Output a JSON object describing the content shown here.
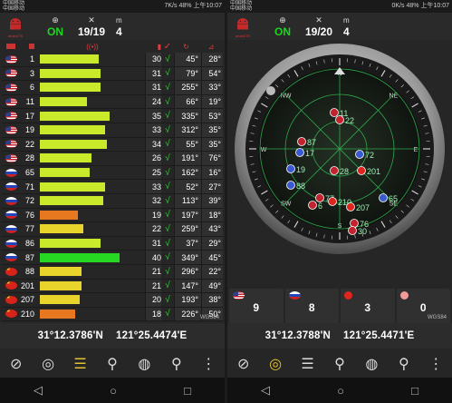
{
  "status_left": {
    "carrier1": "中国移动",
    "carrier2": "中国移动",
    "speed": "7K/s",
    "battery": "48%",
    "time": "上午10:07"
  },
  "status_right": {
    "carrier1": "中国移动",
    "carrier2": "中国移动",
    "speed": "0K/s",
    "battery": "48%",
    "time": "上午10:07"
  },
  "left_header": {
    "brand": "androiTS",
    "state": "ON",
    "sats": "19/19",
    "count": "4",
    "m_label": "m"
  },
  "right_header": {
    "brand": "androiTS",
    "state": "ON",
    "sats": "19/20",
    "count": "4",
    "m_label": "m"
  },
  "table": {
    "rows": [
      {
        "flag": "us",
        "prn": "1",
        "snr": "30",
        "fix": "√",
        "az": "45°",
        "el": "28°",
        "bar": 0.56,
        "color": "#c8ea2a"
      },
      {
        "flag": "us",
        "prn": "3",
        "snr": "31",
        "fix": "√",
        "az": "79°",
        "el": "54°",
        "bar": 0.58,
        "color": "#c8ea2a"
      },
      {
        "flag": "us",
        "prn": "6",
        "snr": "31",
        "fix": "√",
        "az": "255°",
        "el": "33°",
        "bar": 0.58,
        "color": "#c8ea2a"
      },
      {
        "flag": "us",
        "prn": "11",
        "snr": "24",
        "fix": "√",
        "az": "66°",
        "el": "19°",
        "bar": 0.45,
        "color": "#c8ea2a"
      },
      {
        "flag": "us",
        "prn": "17",
        "snr": "35",
        "fix": "√",
        "az": "335°",
        "el": "53°",
        "bar": 0.66,
        "color": "#c8ea2a"
      },
      {
        "flag": "us",
        "prn": "19",
        "snr": "33",
        "fix": "√",
        "az": "312°",
        "el": "35°",
        "bar": 0.62,
        "color": "#c8ea2a"
      },
      {
        "flag": "us",
        "prn": "22",
        "snr": "34",
        "fix": "√",
        "az": "55°",
        "el": "35°",
        "bar": 0.64,
        "color": "#c8ea2a"
      },
      {
        "flag": "us",
        "prn": "28",
        "snr": "26",
        "fix": "√",
        "az": "191°",
        "el": "76°",
        "bar": 0.49,
        "color": "#c8ea2a"
      },
      {
        "flag": "ru",
        "prn": "65",
        "snr": "25",
        "fix": "√",
        "az": "162°",
        "el": "16°",
        "bar": 0.47,
        "color": "#c8ea2a"
      },
      {
        "flag": "ru",
        "prn": "71",
        "snr": "33",
        "fix": "√",
        "az": "52°",
        "el": "27°",
        "bar": 0.62,
        "color": "#c8ea2a"
      },
      {
        "flag": "ru",
        "prn": "72",
        "snr": "32",
        "fix": "√",
        "az": "113°",
        "el": "39°",
        "bar": 0.6,
        "color": "#c8ea2a"
      },
      {
        "flag": "ru",
        "prn": "76",
        "snr": "19",
        "fix": "√",
        "az": "197°",
        "el": "18°",
        "bar": 0.36,
        "color": "#e8781f"
      },
      {
        "flag": "ru",
        "prn": "77",
        "snr": "22",
        "fix": "√",
        "az": "259°",
        "el": "43°",
        "bar": 0.41,
        "color": "#e8d42a"
      },
      {
        "flag": "ru",
        "prn": "86",
        "snr": "31",
        "fix": "√",
        "az": "37°",
        "el": "29°",
        "bar": 0.58,
        "color": "#c8ea2a"
      },
      {
        "flag": "ru",
        "prn": "87",
        "snr": "40",
        "fix": "√",
        "az": "349°",
        "el": "45°",
        "bar": 0.76,
        "color": "#27d822"
      },
      {
        "flag": "cn",
        "prn": "88",
        "snr": "21",
        "fix": "√",
        "az": "296°",
        "el": "22°",
        "bar": 0.4,
        "color": "#e8d42a"
      },
      {
        "flag": "cn",
        "prn": "201",
        "snr": "21",
        "fix": "√",
        "az": "147°",
        "el": "49°",
        "bar": 0.4,
        "color": "#e8d42a"
      },
      {
        "flag": "cn",
        "prn": "207",
        "snr": "20",
        "fix": "√",
        "az": "193°",
        "el": "38°",
        "bar": 0.38,
        "color": "#e8d42a"
      },
      {
        "flag": "cn",
        "prn": "210",
        "snr": "18",
        "fix": "√",
        "az": "226°",
        "el": "50°",
        "bar": 0.34,
        "color": "#e8781f"
      }
    ]
  },
  "left_coords": {
    "lat": "31°12.3786'N",
    "lon": "121°25.4474'E",
    "datum": "WGS84"
  },
  "right_coords": {
    "lat": "31°12.3788'N",
    "lon": "121°25.4471'E",
    "datum": "WGS84"
  },
  "radar": {
    "ring_labels": [
      "N",
      "NE",
      "E",
      "SE",
      "S",
      "SW",
      "W",
      "NW"
    ],
    "sats": [
      {
        "prn": "11",
        "type": "us"
      },
      {
        "prn": "22",
        "type": "us"
      },
      {
        "prn": "87",
        "type": "us"
      },
      {
        "prn": "17",
        "type": "ru"
      },
      {
        "prn": "72",
        "type": "ru"
      },
      {
        "prn": "19",
        "type": "ru"
      },
      {
        "prn": "28",
        "type": "us"
      },
      {
        "prn": "201",
        "type": "cn"
      },
      {
        "prn": "88",
        "type": "ru"
      },
      {
        "prn": "77",
        "type": "us"
      },
      {
        "prn": "6",
        "type": "us"
      },
      {
        "prn": "210",
        "type": "cn"
      },
      {
        "prn": "207",
        "type": "cn"
      },
      {
        "prn": "65",
        "type": "ru"
      },
      {
        "prn": "76",
        "type": "us"
      },
      {
        "prn": "30",
        "type": "us"
      }
    ]
  },
  "counts": [
    {
      "flag": "us",
      "value": "9"
    },
    {
      "flag": "ru",
      "value": "8"
    },
    {
      "flag": "cn",
      "value": "3"
    },
    {
      "flag": "cnlight",
      "value": "0"
    }
  ]
}
